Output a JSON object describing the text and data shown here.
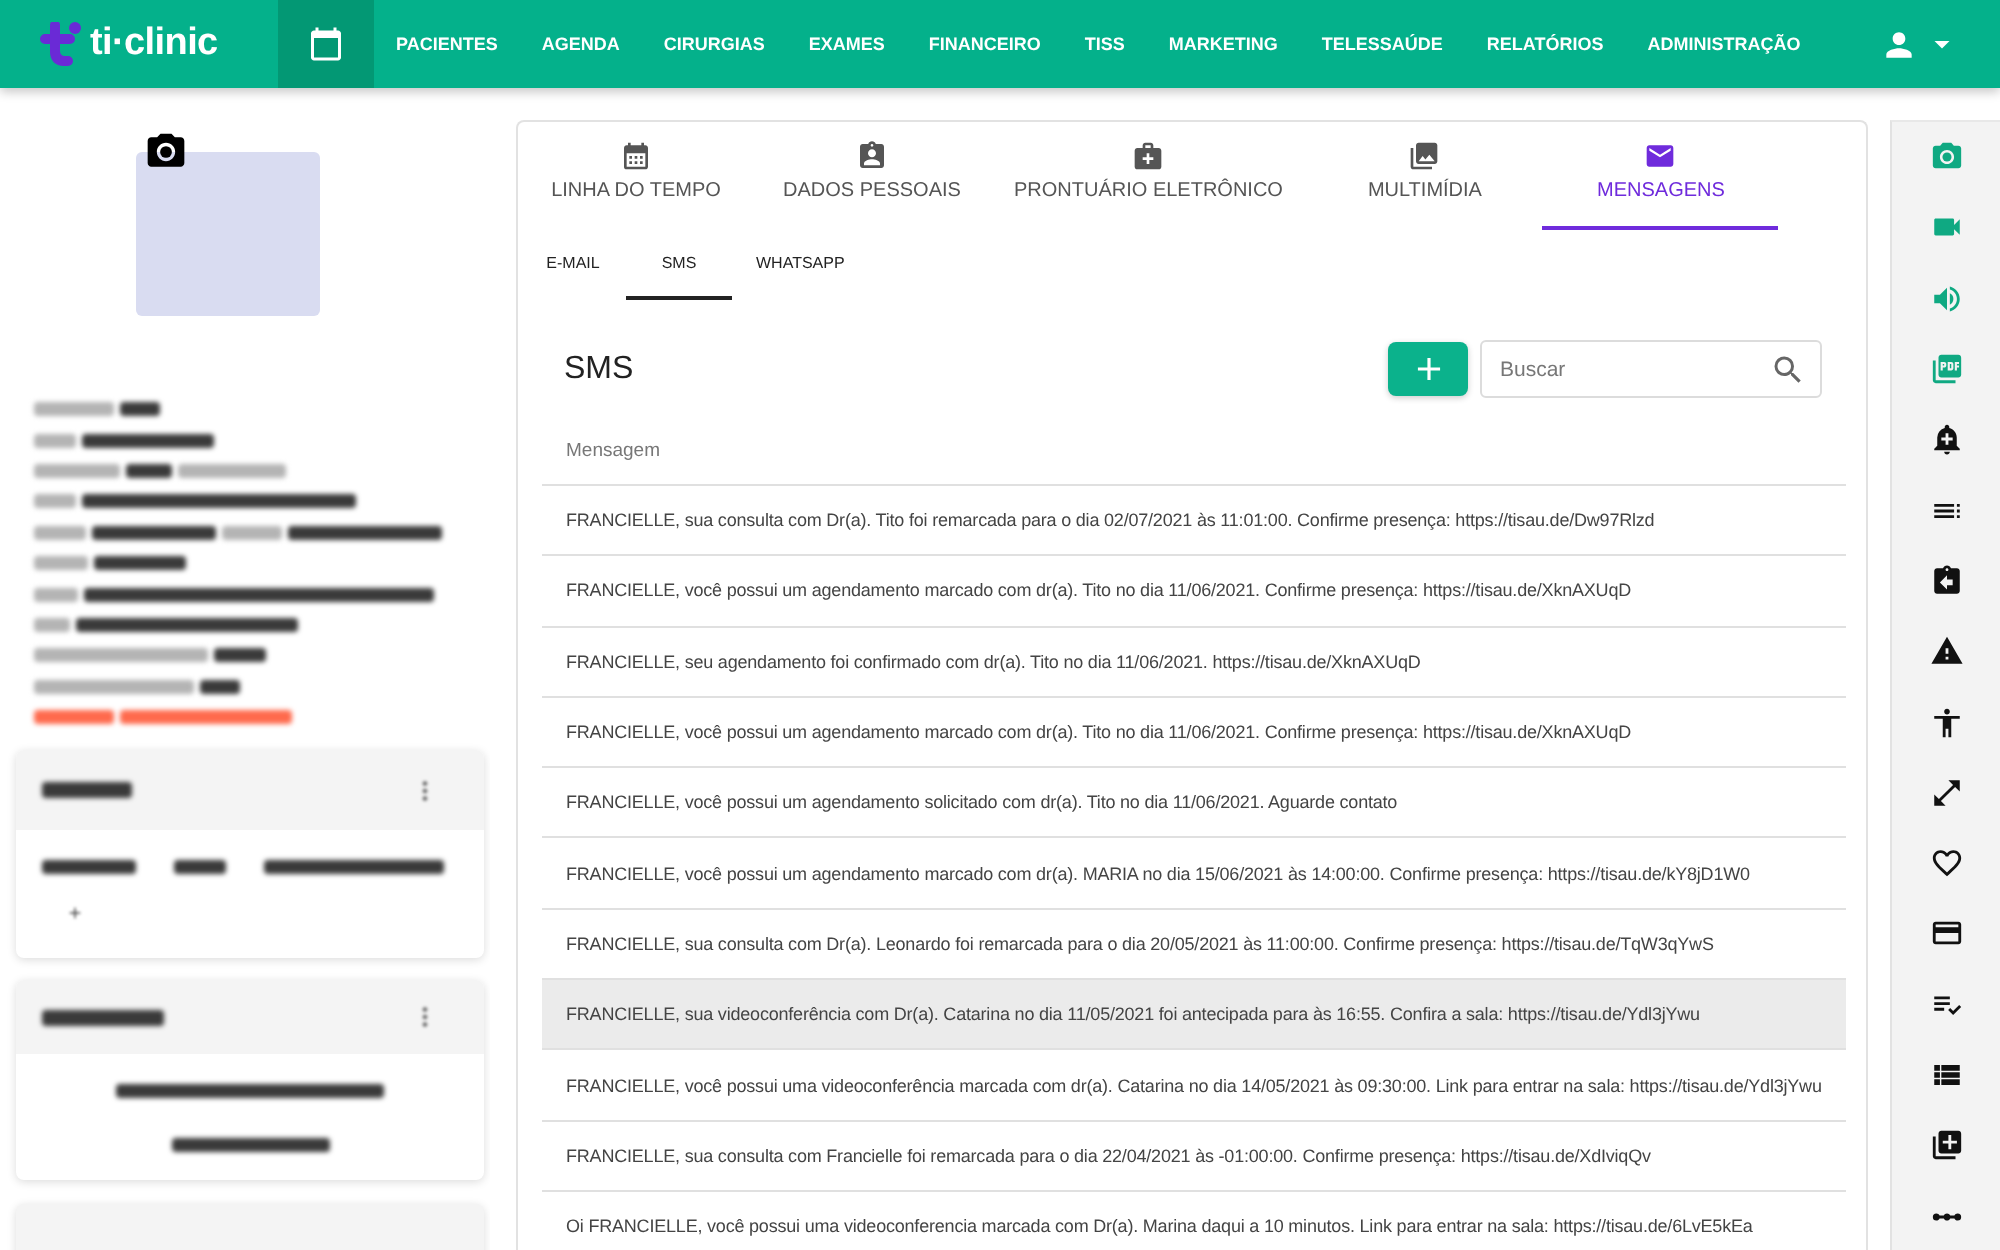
{
  "app_bar": {
    "logo": "ti·clinic",
    "nav": [
      "PACIENTES",
      "AGENDA",
      "CIRURGIAS",
      "EXAMES",
      "FINANCEIRO",
      "TISS",
      "MARKETING",
      "TELESSAÚDE",
      "RELATÓRIOS",
      "ADMINISTRAÇÃO"
    ]
  },
  "tabs": [
    {
      "label": "LINHA DO TEMPO",
      "selected": false
    },
    {
      "label": "DADOS PESSOAIS",
      "selected": false
    },
    {
      "label": "PRONTUÁRIO ELETRÔNICO",
      "selected": false
    },
    {
      "label": "MULTIMÍDIA",
      "selected": false
    },
    {
      "label": "MENSAGENS",
      "selected": true
    }
  ],
  "subtabs": [
    {
      "label": "E-MAIL",
      "selected": false
    },
    {
      "label": "SMS",
      "selected": true
    },
    {
      "label": "WHATSAPP",
      "selected": false
    }
  ],
  "sms_panel": {
    "title": "SMS",
    "search": {
      "placeholder": "Buscar"
    },
    "table": {
      "columns": [
        "Mensagem"
      ],
      "rows": [
        {
          "message": "FRANCIELLE, sua consulta com Dr(a). Tito foi remarcada para o dia 02/07/2021 às 11:01:00. Confirme presença: https://tisau.de/Dw97Rlzd",
          "hovered": false
        },
        {
          "message": "FRANCIELLE, você possui um agendamento marcado com dr(a). Tito no dia 11/06/2021. Confirme presença: https://tisau.de/XknAXUqD",
          "hovered": false
        },
        {
          "message": "FRANCIELLE, seu agendamento foi confirmado com dr(a). Tito no dia 11/06/2021. https://tisau.de/XknAXUqD",
          "hovered": false
        },
        {
          "message": "FRANCIELLE, você possui um agendamento marcado com dr(a). Tito no dia 11/06/2021. Confirme presença: https://tisau.de/XknAXUqD",
          "hovered": false
        },
        {
          "message": "FRANCIELLE, você possui um agendamento solicitado com dr(a). Tito no dia 11/06/2021. Aguarde contato",
          "hovered": false
        },
        {
          "message": "FRANCIELLE, você possui um agendamento marcado com dr(a). MARIA no dia 15/06/2021 às 14:00:00. Confirme presença: https://tisau.de/kY8jD1W0",
          "hovered": false
        },
        {
          "message": "FRANCIELLE, sua consulta com Dr(a). Leonardo foi remarcada para o dia 20/05/2021 às 11:00:00. Confirme presença: https://tisau.de/TqW3qYwS",
          "hovered": false
        },
        {
          "message": "FRANCIELLE, sua videoconferência com Dr(a). Catarina no dia 11/05/2021 foi antecipada para às 16:55. Confira a sala: https://tisau.de/Ydl3jYwu",
          "hovered": true
        },
        {
          "message": "FRANCIELLE, você possui uma videoconferência marcada com dr(a). Catarina no dia 14/05/2021 às 09:30:00. Link para entrar na sala: https://tisau.de/Ydl3jYwu",
          "hovered": false
        },
        {
          "message": "FRANCIELLE, sua consulta com Francielle foi remarcada para o dia 22/04/2021 às -01:00:00. Confirme presença: https://tisau.de/XdIviqQv",
          "hovered": false
        },
        {
          "message": "Oi FRANCIELLE, você possui uma videoconferencia marcada com Dr(a). Marina daqui a 10 minutos. Link para entrar na sala: https://tisau.de/6LvE5kEa",
          "hovered": false
        }
      ]
    }
  },
  "side_toolbar": [
    {
      "color": "#0fa982"
    },
    {
      "color": "#0fa982"
    },
    {
      "color": "#0fa982"
    },
    {
      "color": "#0fa982"
    },
    {
      "color": "#111111"
    },
    {
      "color": "#111111"
    },
    {
      "color": "#111111"
    },
    {
      "color": "#111111"
    },
    {
      "color": "#111111"
    },
    {
      "color": "#111111"
    },
    {
      "color": "#111111"
    },
    {
      "color": "#111111"
    },
    {
      "color": "#111111"
    },
    {
      "color": "#111111"
    },
    {
      "color": "#111111"
    },
    {
      "color": "#111111"
    }
  ]
}
